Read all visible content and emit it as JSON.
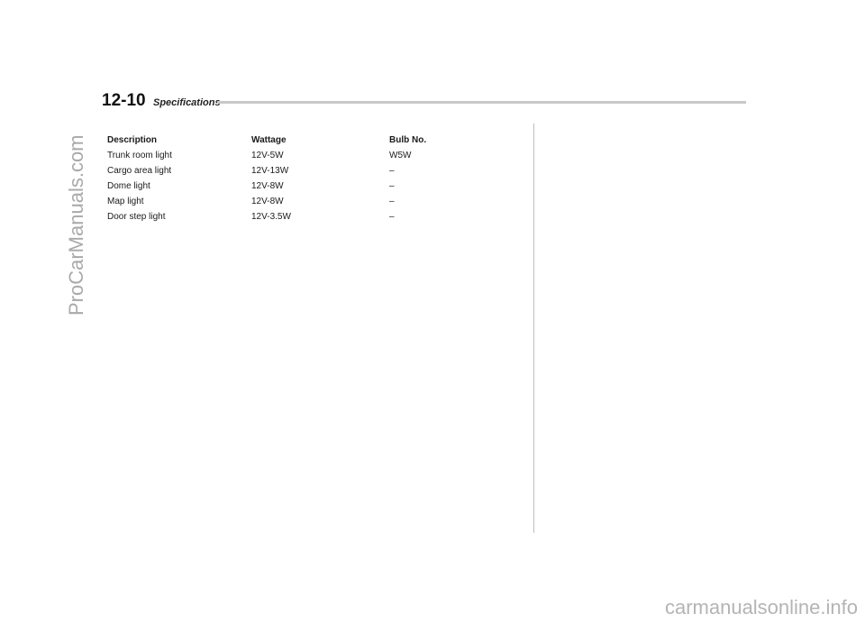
{
  "watermarks": {
    "side": "ProCarManuals.com",
    "bottom": "carmanualsonline.info"
  },
  "header": {
    "page_number": "12-10",
    "section_title": "Specifications"
  },
  "table": {
    "columns": [
      "Description",
      "Wattage",
      "Bulb No."
    ],
    "rows": [
      [
        "Trunk room light",
        "12V-5W",
        "W5W"
      ],
      [
        "Cargo area light",
        "12V-13W",
        "–"
      ],
      [
        "Dome light",
        "12V-8W",
        "–"
      ],
      [
        "Map light",
        "12V-8W",
        "–"
      ],
      [
        "Door step light",
        "12V-3.5W",
        "–"
      ]
    ]
  }
}
